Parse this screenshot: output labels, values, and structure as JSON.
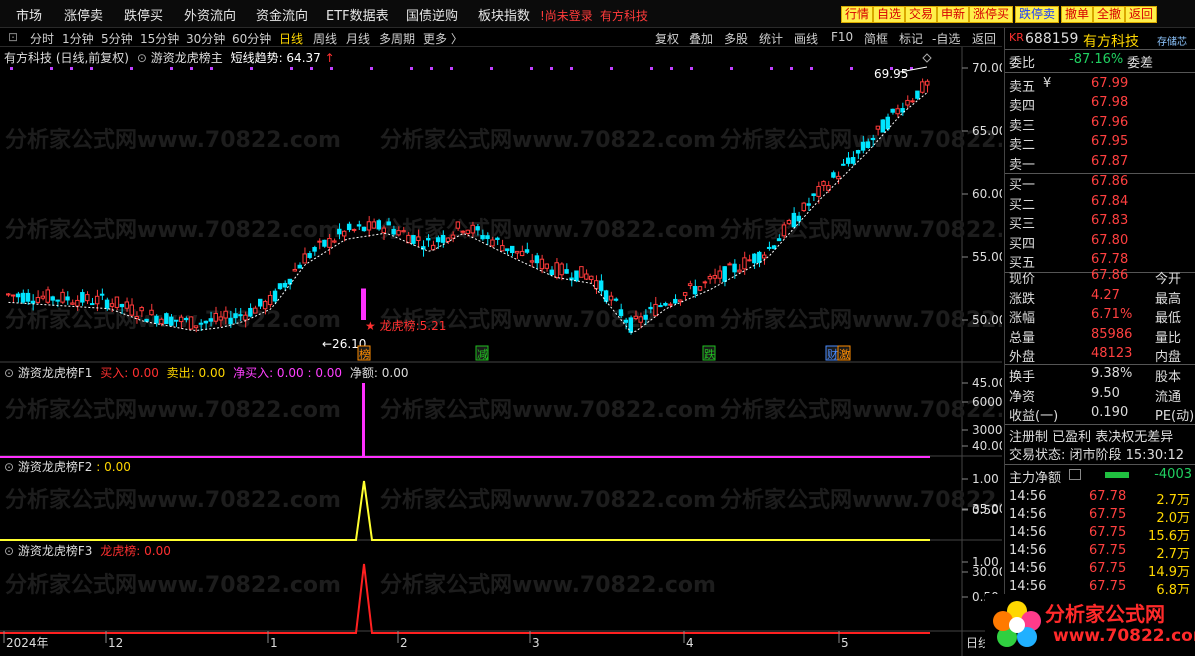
{
  "menu": [
    "市场",
    "涨停卖",
    "跌停买",
    "外资流向",
    "资金流向",
    "ETF数据表",
    "国债逆购",
    "板块指数"
  ],
  "login_text": "!尚未登录",
  "top_stock": "有方科技",
  "quick_buttons": [
    {
      "label": "行情",
      "blue": false
    },
    {
      "label": "自选",
      "blue": false
    },
    {
      "label": "交易",
      "blue": false
    },
    {
      "label": "申新",
      "blue": false
    },
    {
      "label": "涨停买",
      "blue": false
    },
    {
      "label": "跌停卖",
      "blue": true
    },
    {
      "label": "撤单",
      "blue": false
    },
    {
      "label": "全撤",
      "blue": false
    },
    {
      "label": "返回",
      "blue": false
    }
  ],
  "periods": [
    "分时",
    "1分钟",
    "5分钟",
    "15分钟",
    "30分钟",
    "60分钟",
    "日线",
    "周线",
    "月线",
    "多周期",
    "更多 〉"
  ],
  "active_period": "日线",
  "tools": [
    "复权",
    "叠加",
    "多股",
    "统计",
    "画线",
    "F10",
    "简框",
    "标记",
    "-自选",
    "返回"
  ],
  "main_header": {
    "name": "有方科技 (日线,前复权)",
    "indicator": "游资龙虎榜主",
    "trend_label": "短线趋势: 64.37",
    "arrow": "↑"
  },
  "price_axis": [
    "70.00",
    "65.00",
    "60.00",
    "55.00",
    "50.00",
    "45.00",
    "40.00",
    "35.00",
    "30.00"
  ],
  "annotations": {
    "high": "69.95",
    "low": "26.10",
    "dragon": "★ 龙虎榜:5.21"
  },
  "markers": [
    {
      "label": "榜",
      "color": "#ff8c00"
    },
    {
      "label": "减",
      "color": "#20c020"
    },
    {
      "label": "跌",
      "color": "#20c020"
    },
    {
      "label": "财",
      "color": "#4a8cff"
    },
    {
      "label": "激",
      "color": "#ff8c00"
    }
  ],
  "f1": {
    "name": "游资龙虎榜F1",
    "buy": "买入: 0.00",
    "sell": "卖出: 0.00",
    "net": "净买入: 0.00",
    "colon": ": 0.00",
    "amount": "净额: 0.00",
    "axis": [
      "6000",
      "3000"
    ]
  },
  "f2": {
    "name": "游资龙虎榜F2",
    "val": ": 0.00",
    "axis": [
      "1.00",
      "0.50"
    ]
  },
  "f3": {
    "name": "游资龙虎榜F3",
    "val": "龙虎榜: 0.00",
    "axis": [
      "1.00",
      "0.50"
    ]
  },
  "time_axis": [
    "2024年",
    "12",
    "1",
    "2",
    "3",
    "4",
    "5"
  ],
  "time_axis_right": "日线",
  "quote": {
    "code": "688159",
    "name": "有方科技",
    "kr": "KR",
    "store": "存储芯",
    "weibi_label": "委比",
    "weibi_val": "-87.16%",
    "weicha_label": "委差",
    "sells": [
      {
        "l": "卖五",
        "p": "67.99",
        "yen": "¥"
      },
      {
        "l": "卖四",
        "p": "67.98"
      },
      {
        "l": "卖三",
        "p": "67.96"
      },
      {
        "l": "卖二",
        "p": "67.95"
      },
      {
        "l": "卖一",
        "p": "67.87"
      }
    ],
    "buys": [
      {
        "l": "买一",
        "p": "67.86"
      },
      {
        "l": "买二",
        "p": "67.84"
      },
      {
        "l": "买三",
        "p": "67.83"
      },
      {
        "l": "买四",
        "p": "67.80"
      },
      {
        "l": "买五",
        "p": "67.78"
      }
    ],
    "stats": [
      {
        "l": "现价",
        "v": "67.86",
        "r": "今开"
      },
      {
        "l": "涨跌",
        "v": "4.27",
        "r": "最高"
      },
      {
        "l": "涨幅",
        "v": "6.71%",
        "r": "最低"
      },
      {
        "l": "总量",
        "v": "85986",
        "r": "量比"
      },
      {
        "l": "外盘",
        "v": "48123",
        "r": "内盘"
      }
    ],
    "stats2": [
      {
        "l": "换手",
        "v": "9.38%",
        "r": "股本"
      },
      {
        "l": "净资",
        "v": "9.50",
        "r": "流通"
      },
      {
        "l": "收益(一)",
        "v": "0.190",
        "r": "PE(动)"
      }
    ],
    "status_line": "注册制 已盈利 表决权无差异",
    "trade_status": "交易状态: 闭市阶段 15:30:12",
    "main_flow_label": "主力净额",
    "main_flow_val": "-4003",
    "ticks": [
      {
        "t": "14:56",
        "p": "67.78",
        "v": "2.7万"
      },
      {
        "t": "14:56",
        "p": "67.75",
        "v": "2.0万"
      },
      {
        "t": "14:56",
        "p": "67.75",
        "v": "15.6万"
      },
      {
        "t": "14:56",
        "p": "67.75",
        "v": "2.7万"
      },
      {
        "t": "14:56",
        "p": "67.75",
        "v": "14.9万"
      },
      {
        "t": "14:56",
        "p": "67.75",
        "v": "6.8万"
      }
    ]
  },
  "watermark": "分析家公式网www.70822.com",
  "logo": {
    "title": "分析家公式网",
    "url": "www.70822.com"
  }
}
